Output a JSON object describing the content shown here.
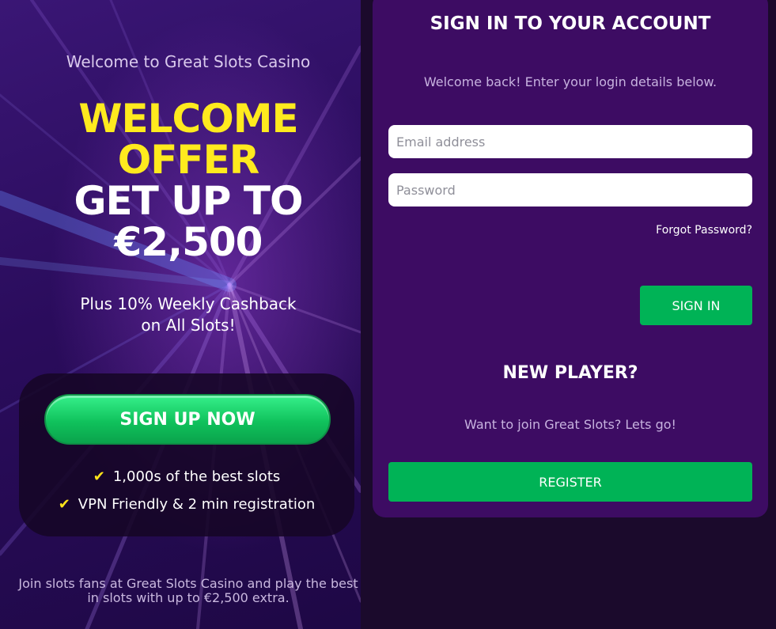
{
  "promo": {
    "welcome": "Welcome to Great Slots Casino",
    "headline_line1": "WELCOME",
    "headline_line2": "OFFER",
    "headline_line3": "GET UP TO",
    "headline_line4": "€2,500",
    "cashback_line1": "Plus 10% Weekly Cashback",
    "cashback_line2": "on All Slots!",
    "signup_label": "SIGN UP NOW",
    "features": [
      "1,000s of the best slots",
      "VPN Friendly & 2 min registration"
    ],
    "footer_line1": "Join slots fans at Great Slots Casino and play the best",
    "footer_line2": "in slots with up to €2,500 extra."
  },
  "signin": {
    "title": "SIGN IN TO YOUR ACCOUNT",
    "subtitle": "Welcome back! Enter your login details below.",
    "email_placeholder": "Email address",
    "password_placeholder": "Password",
    "forgot_label": "Forgot Password?",
    "signin_label": "SIGN IN"
  },
  "register": {
    "title": "NEW PLAYER?",
    "subtitle": "Want to join Great Slots? Lets go!",
    "register_label": "REGISTER"
  },
  "colors": {
    "accent_green": "#00b356",
    "headline_yellow": "#ffea1e",
    "panel_purple": "#3d0c63",
    "page_background": "#1b0a2c"
  },
  "icons": {
    "feature_check": "check-icon"
  }
}
